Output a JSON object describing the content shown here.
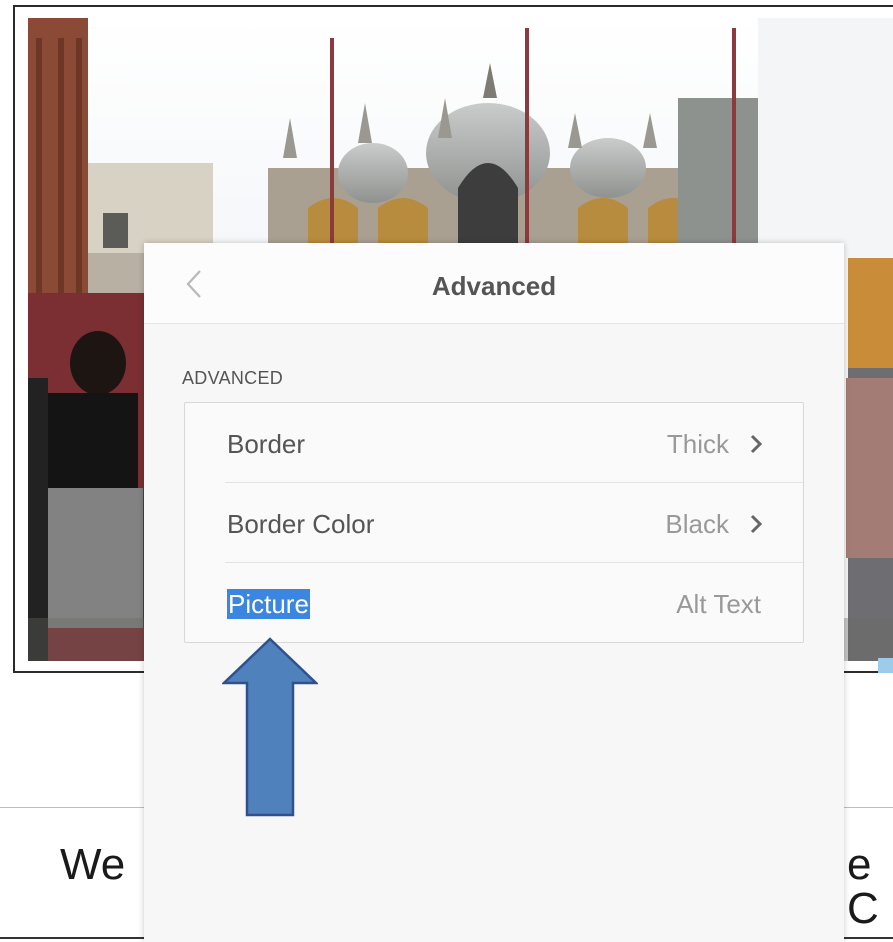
{
  "page": {
    "heading_left": "We",
    "heading_right": "e C"
  },
  "panel": {
    "title": "Advanced",
    "back_icon": "chevron-left-icon",
    "section_label": "ADVANCED",
    "rows": [
      {
        "label": "Border",
        "value": "Thick",
        "icon": "chevron-right-icon"
      },
      {
        "label": "Border Color",
        "value": "Black",
        "icon": "chevron-right-icon"
      },
      {
        "label": "Picture",
        "value": "Alt Text"
      }
    ]
  },
  "colors": {
    "selection": "#3b86e0",
    "arrow_fill": "#4f81bd",
    "arrow_stroke": "#2f528f",
    "panel_bg": "#f7f7f7"
  }
}
